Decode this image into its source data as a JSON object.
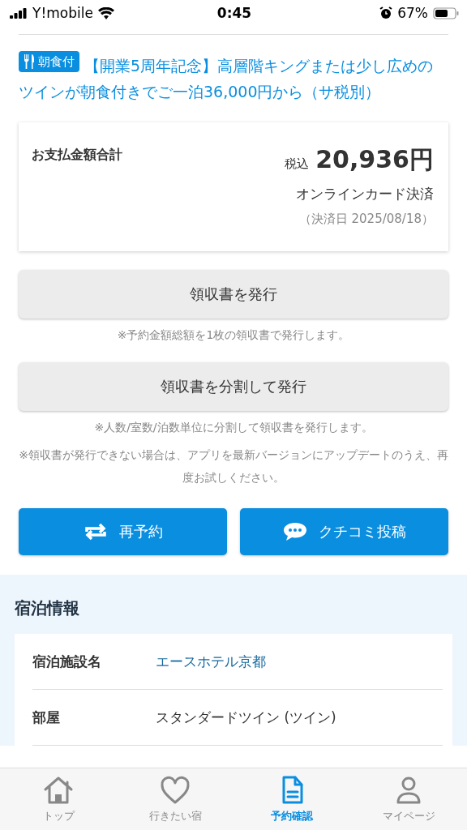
{
  "status_bar": {
    "carrier": "Y!mobile",
    "time": "0:45",
    "battery": "67%"
  },
  "plan": {
    "badge": "朝食付",
    "title": "【開業5周年記念】高層階キングまたは少し広めのツインが朝食付きでご一泊36,000円から（サ税別）"
  },
  "payment": {
    "label": "お支払金額合計",
    "tax_note": "税込",
    "amount": "20,936円",
    "method": "オンラインカード決済",
    "date": "（決済日 2025/08/18）"
  },
  "receipt_buttons": [
    {
      "label": "領収書を発行",
      "notes": [
        "※予約金額総額を1枚の領収書で発行します。"
      ]
    },
    {
      "label": "領収書を分割して発行",
      "notes": [
        "※人数/室数/泊数単位に分割して領収書を発行します。",
        "※領収書が発行できない場合は、アプリを最新バージョンにアップデートのうえ、再度お試しください。"
      ]
    }
  ],
  "actions": [
    {
      "label": "再予約",
      "kind": "repeat"
    },
    {
      "label": "クチコミ投稿",
      "kind": "comment"
    }
  ],
  "stay_info": {
    "title": "宿泊情報",
    "rows": [
      {
        "label": "宿泊施設名",
        "value": "エースホテル京都",
        "kind": "link"
      },
      {
        "label": "部屋",
        "value": "スタンダードツイン (ツイン)",
        "kind": "text"
      }
    ]
  },
  "tab_bar": [
    {
      "label": "トップ",
      "kind": "home",
      "selected": false
    },
    {
      "label": "行きたい宿",
      "kind": "heart",
      "selected": false
    },
    {
      "label": "予約確認",
      "kind": "document",
      "selected": true
    },
    {
      "label": "マイページ",
      "kind": "person",
      "selected": false
    }
  ]
}
